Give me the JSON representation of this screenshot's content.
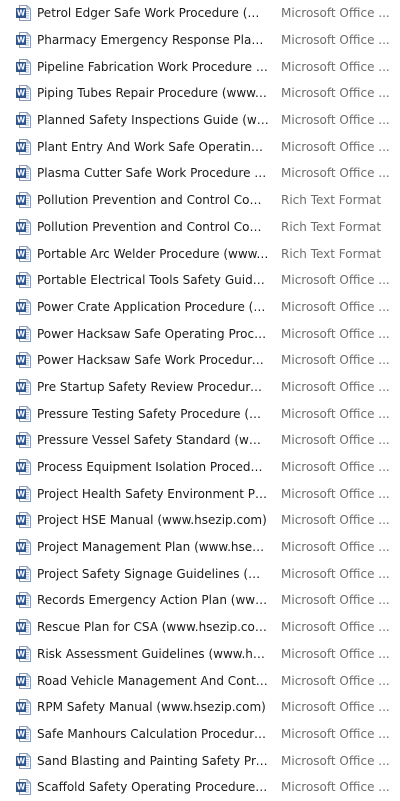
{
  "files": [
    {
      "name": "Petrol Edger Safe Work Procedure (www...",
      "type": "Microsoft Office ...",
      "icon": "word-document-icon"
    },
    {
      "name": "Pharmacy Emergency Response Plan (w...",
      "type": "Microsoft Office ...",
      "icon": "word-document-icon"
    },
    {
      "name": "Pipeline Fabrication Work Procedure (ww...",
      "type": "Microsoft Office ...",
      "icon": "word-document-icon"
    },
    {
      "name": "Piping Tubes Repair Procedure (www.hse...",
      "type": "Microsoft Office ...",
      "icon": "word-document-icon"
    },
    {
      "name": "Planned Safety Inspections Guide (www....",
      "type": "Microsoft Office ...",
      "icon": "word-document-icon"
    },
    {
      "name": "Plant Entry And Work Safe Operating Pro...",
      "type": "Microsoft Office ...",
      "icon": "word-document-icon"
    },
    {
      "name": "Plasma Cutter Safe Work Procedure (ww...",
      "type": "Microsoft Office ...",
      "icon": "word-document-icon"
    },
    {
      "name": "Pollution Prevention and Control Code o...",
      "type": "Rich Text Format",
      "icon": "word-document-icon"
    },
    {
      "name": "Pollution Prevention and Control Code o...",
      "type": "Rich Text Format",
      "icon": "word-document-icon"
    },
    {
      "name": "Portable Arc Welder Procedure (www.hse...",
      "type": "Rich Text Format",
      "icon": "word-document-icon"
    },
    {
      "name": "Portable Electrical Tools Safety Guide (w...",
      "type": "Microsoft Office ...",
      "icon": "word-document-icon"
    },
    {
      "name": "Power Crate Application Procedure (ww...",
      "type": "Microsoft Office ...",
      "icon": "word-document-icon"
    },
    {
      "name": "Power Hacksaw Safe Operating Procedur...",
      "type": "Microsoft Office ...",
      "icon": "word-document-icon"
    },
    {
      "name": "Power Hacksaw Safe Work Procedure (w...",
      "type": "Microsoft Office ...",
      "icon": "word-document-icon"
    },
    {
      "name": "Pre Startup Safety Review Procedure (ww...",
      "type": "Microsoft Office ...",
      "icon": "word-document-icon"
    },
    {
      "name": "Pressure Testing Safety Procedure (www....",
      "type": "Microsoft Office ...",
      "icon": "word-document-icon"
    },
    {
      "name": "Pressure Vessel Safety Standard (www.hs...",
      "type": "Microsoft Office ...",
      "icon": "word-document-icon"
    },
    {
      "name": "Process Equipment Isolation Procedure (...",
      "type": "Microsoft Office ...",
      "icon": "word-document-icon"
    },
    {
      "name": "Project Health Safety Environment Plan (...",
      "type": "Microsoft Office ...",
      "icon": "word-document-icon"
    },
    {
      "name": "Project HSE Manual (www.hsezip.com)",
      "type": "Microsoft Office ...",
      "icon": "word-document-icon"
    },
    {
      "name": "Project Management Plan (www.hsezip.c...",
      "type": "Microsoft Office ...",
      "icon": "word-document-icon"
    },
    {
      "name": "Project Safety Signage Guidelines (www....",
      "type": "Microsoft Office ...",
      "icon": "word-document-icon"
    },
    {
      "name": "Records Emergency Action Plan (www.hs...",
      "type": "Microsoft Office ...",
      "icon": "word-document-icon"
    },
    {
      "name": "Rescue Plan for CSA (www.hsezip.com)",
      "type": "Microsoft Office ...",
      "icon": "word-document-icon"
    },
    {
      "name": "Risk Assessment Guidelines (www.hsezip....",
      "type": "Microsoft Office ...",
      "icon": "word-document-icon"
    },
    {
      "name": "Road Vehicle Management And Control ...",
      "type": "Microsoft Office ...",
      "icon": "word-document-icon"
    },
    {
      "name": "RPM Safety Manual (www.hsezip.com)",
      "type": "Microsoft Office ...",
      "icon": "word-document-icon"
    },
    {
      "name": "Safe Manhours Calculation Procedure (w...",
      "type": "Microsoft Office ...",
      "icon": "word-document-icon"
    },
    {
      "name": "Sand Blasting and Painting Safety Proced...",
      "type": "Microsoft Office ...",
      "icon": "word-document-icon"
    },
    {
      "name": "Scaffold Safety Operating Procedure (ww...",
      "type": "Microsoft Office ...",
      "icon": "word-document-icon"
    }
  ],
  "colors": {
    "icon_blue": "#2b5797",
    "icon_border": "#5b7fb5",
    "type_text": "#6d6d6d"
  }
}
